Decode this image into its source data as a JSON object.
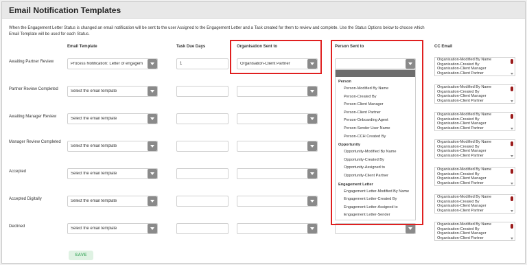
{
  "page": {
    "title": "Email Notification Templates",
    "description": "When the Engagement Letter Status is changed an email notification will be sent to the user Assigned to the Engagement Letter and a Task created for them to review and complete. Use the Status Options below to choose which Email Template will be used for each Status."
  },
  "columns": {
    "email_template": "Email Template",
    "task_due_days": "Task Due Days",
    "organisation_sent_to": "Organisation Sent to",
    "person_sent_to": "Person Sent to",
    "cc_email": "CC Email"
  },
  "rows": [
    {
      "label": "Awaiting Partner Review",
      "template": "Process Notification: Letter of engagem",
      "days": "1",
      "org": "Organisation-Client Partner",
      "person": ""
    },
    {
      "label": "Partner Review Completed",
      "template": "Select the email template",
      "days": "",
      "org": "",
      "person": ""
    },
    {
      "label": "Awaiting Manager Review",
      "template": "Select the email template",
      "days": "",
      "org": "",
      "person": ""
    },
    {
      "label": "Manager Review Completed",
      "template": "Select the email template",
      "days": "",
      "org": "",
      "person": ""
    },
    {
      "label": "Accepted",
      "template": "Select the email template",
      "days": "",
      "org": "",
      "person": ""
    },
    {
      "label": "Accepted Digitally",
      "template": "Select the email template",
      "days": "",
      "org": "",
      "person": ""
    },
    {
      "label": "Declined",
      "template": "Select the email template",
      "days": "",
      "org": "",
      "person": ""
    }
  ],
  "cc_options": [
    "Organisation-Modified By Name",
    "Organisation-Created By",
    "Organisation-Client Manager",
    "Organisation-Client Partner"
  ],
  "person_dropdown": {
    "groups": [
      {
        "label": "Person",
        "options": [
          "Person-Modified By Name",
          "Person-Created By",
          "Person-Client Manager",
          "Person-Client Partner",
          "Person-Onboarding Agent",
          "Person-Sender User Name",
          "Person-CCH Created By"
        ]
      },
      {
        "label": "Opportunity",
        "options": [
          "Opportunity-Modified By Name",
          "Opportunity-Created By",
          "Opportunity-Assigned to",
          "Opportunity-Client Partner"
        ]
      },
      {
        "label": "Engagement Letter",
        "options": [
          "Engagement Letter-Modified By Name",
          "Engagement Letter-Created By",
          "Engagement Letter-Assigned to",
          "Engagement Letter-Sender"
        ]
      }
    ]
  },
  "actions": {
    "save_label": "SAVE"
  },
  "colors": {
    "highlight": "#e02020",
    "scroll_thumb": "#9b1b1b",
    "save_bg": "#dff2e3",
    "save_text": "#4caf6a"
  }
}
